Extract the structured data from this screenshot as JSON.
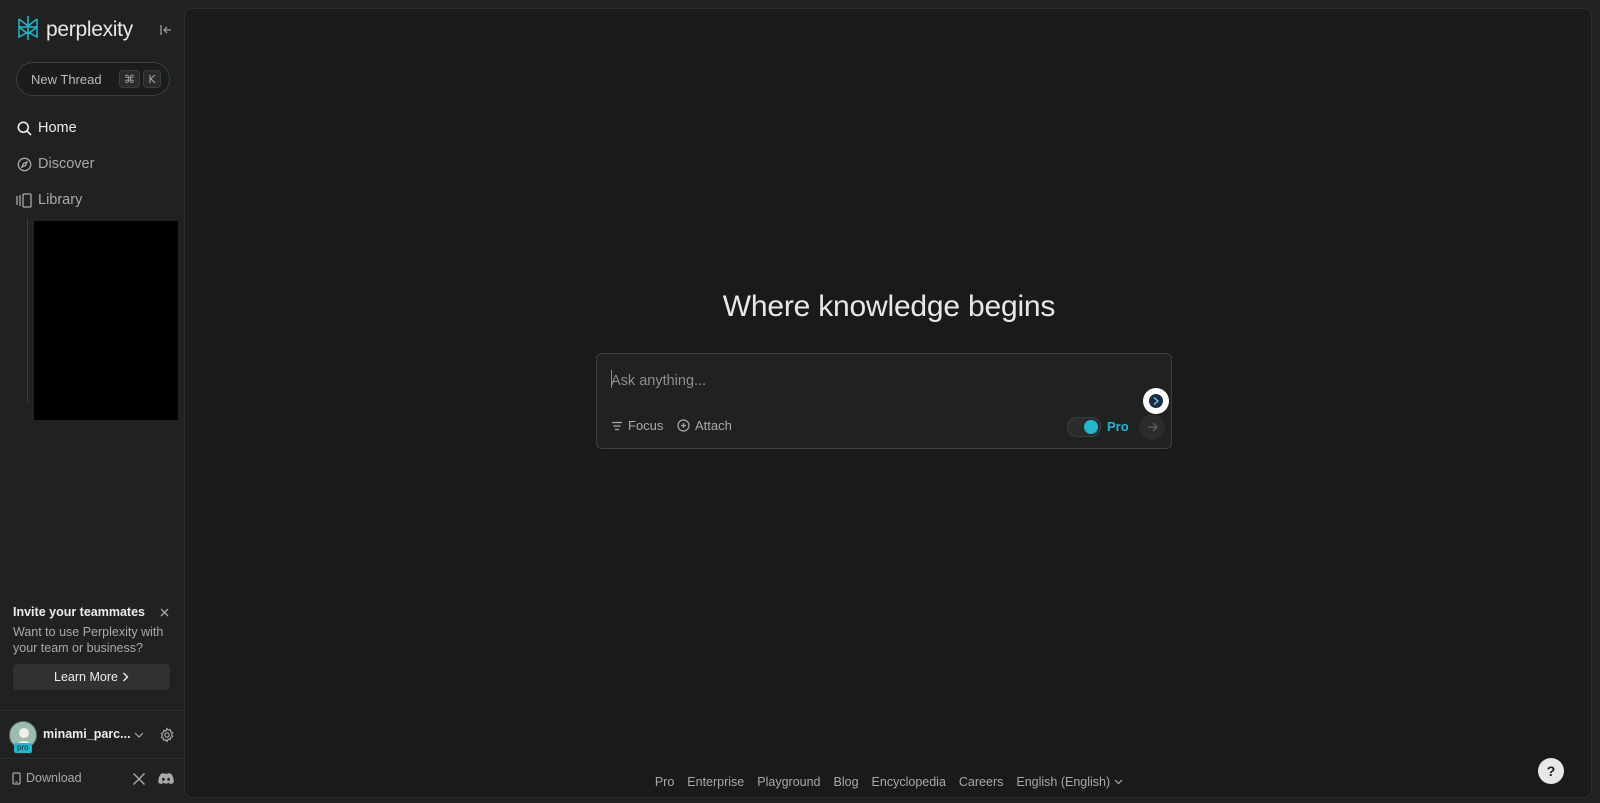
{
  "brand": {
    "name": "perplexity",
    "accent": "#1fb8cd"
  },
  "sidebar": {
    "new_thread": {
      "label": "New Thread",
      "shortcut_keys": [
        "⌘",
        "K"
      ]
    },
    "items": [
      {
        "label": "Home",
        "icon": "search-icon"
      },
      {
        "label": "Discover",
        "icon": "compass-icon"
      },
      {
        "label": "Library",
        "icon": "library-icon"
      }
    ],
    "invite": {
      "title": "Invite your teammates",
      "description": "Want to use Perplexity with your team or business?",
      "cta": "Learn More"
    },
    "user": {
      "name": "minami_parc...",
      "badge": "pro"
    },
    "download": "Download"
  },
  "main": {
    "headline": "Where knowledge begins",
    "search": {
      "placeholder": "Ask anything...",
      "focus_label": "Focus",
      "attach_label": "Attach",
      "pro_label": "Pro",
      "pro_enabled": true
    },
    "footer_links": [
      "Pro",
      "Enterprise",
      "Playground",
      "Blog",
      "Encyclopedia",
      "Careers",
      "English (English)"
    ],
    "help": "?"
  }
}
